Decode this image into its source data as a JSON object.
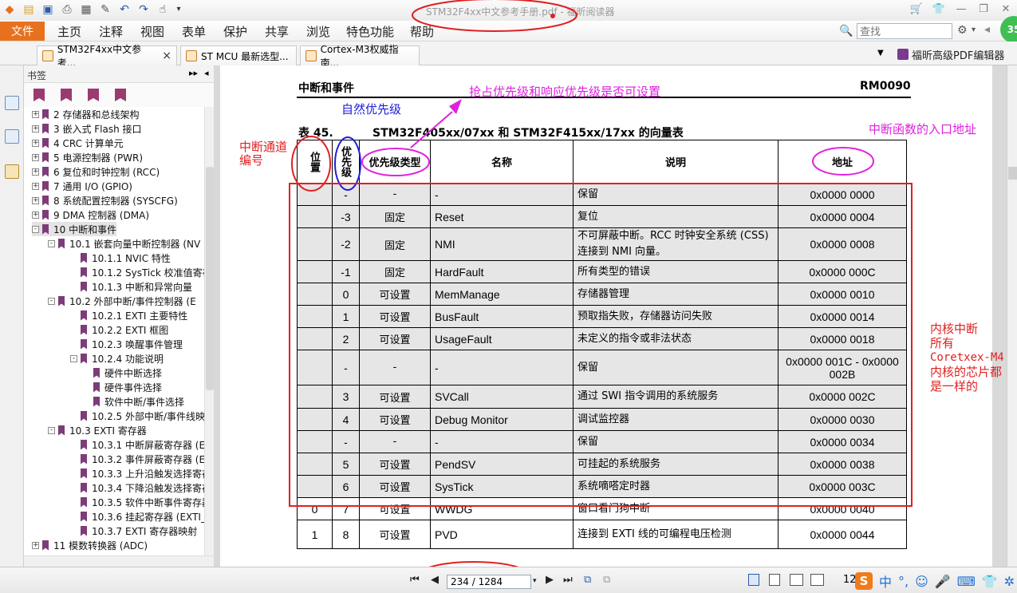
{
  "window": {
    "title": "STM32F4xx中文参考手册.pdf - 福昕阅读器",
    "min_icon": "minimize-icon",
    "max_icon": "restore-icon",
    "close_label": "✕"
  },
  "menu": {
    "file": "文件",
    "items": [
      "主页",
      "注释",
      "视图",
      "表单",
      "保护",
      "共享",
      "浏览",
      "特色功能",
      "帮助"
    ],
    "search_placeholder": "查找"
  },
  "tabs": [
    {
      "label": "STM32F4xx中文参考..."
    },
    {
      "label": "ST MCU 最新选型..."
    },
    {
      "label": "Cortex-M3权威指南..."
    }
  ],
  "editor_button": "福昕高级PDF编辑器",
  "green_badge": "35",
  "bookmarks": {
    "title": "书签",
    "items": [
      {
        "label": "2 存储器和总线架构",
        "level": 0,
        "toggle": "+"
      },
      {
        "label": "3 嵌入式 Flash 接口",
        "level": 0,
        "toggle": "+"
      },
      {
        "label": "4 CRC 计算单元",
        "level": 0,
        "toggle": "+"
      },
      {
        "label": "5 电源控制器 (PWR)",
        "level": 0,
        "toggle": "+"
      },
      {
        "label": "6 复位和时钟控制 (RCC)",
        "level": 0,
        "toggle": "+"
      },
      {
        "label": "7 通用 I/O (GPIO)",
        "level": 0,
        "toggle": "+"
      },
      {
        "label": "8 系统配置控制器 (SYSCFG)",
        "level": 0,
        "toggle": "+"
      },
      {
        "label": "9 DMA 控制器 (DMA)",
        "level": 0,
        "toggle": "+"
      },
      {
        "label": "10 中断和事件",
        "level": 0,
        "toggle": "-",
        "selected": true
      },
      {
        "label": "10.1 嵌套向量中断控制器 (NV",
        "level": 1,
        "toggle": "-"
      },
      {
        "label": "10.1.1 NVIC 特性",
        "level": 2,
        "toggle": ""
      },
      {
        "label": "10.1.2 SysTick 校准值寄存",
        "level": 2,
        "toggle": ""
      },
      {
        "label": "10.1.3 中断和异常向量",
        "level": 2,
        "toggle": ""
      },
      {
        "label": "10.2 外部中断/事件控制器 (E",
        "level": 1,
        "toggle": "-"
      },
      {
        "label": "10.2.1 EXTI 主要特性",
        "level": 2,
        "toggle": ""
      },
      {
        "label": "10.2.2 EXTI 框图",
        "level": 2,
        "toggle": ""
      },
      {
        "label": "10.2.3 唤醒事件管理",
        "level": 2,
        "toggle": ""
      },
      {
        "label": "10.2.4 功能说明",
        "level": 2,
        "toggle": "-"
      },
      {
        "label": "硬件中断选择",
        "level": 3,
        "toggle": ""
      },
      {
        "label": "硬件事件选择",
        "level": 3,
        "toggle": ""
      },
      {
        "label": "软件中断/事件选择",
        "level": 3,
        "toggle": ""
      },
      {
        "label": "10.2.5 外部中断/事件线映",
        "level": 2,
        "toggle": ""
      },
      {
        "label": "10.3 EXTI 寄存器",
        "level": 1,
        "toggle": "-"
      },
      {
        "label": "10.3.1 中断屏蔽寄存器 (E",
        "level": 2,
        "toggle": ""
      },
      {
        "label": "10.3.2 事件屏蔽寄存器 (E",
        "level": 2,
        "toggle": ""
      },
      {
        "label": "10.3.3 上升沿触发选择寄存",
        "level": 2,
        "toggle": ""
      },
      {
        "label": "10.3.4 下降沿触发选择寄存",
        "level": 2,
        "toggle": ""
      },
      {
        "label": "10.3.5 软件中断事件寄存器",
        "level": 2,
        "toggle": ""
      },
      {
        "label": "10.3.6 挂起寄存器 (EXTI_",
        "level": 2,
        "toggle": ""
      },
      {
        "label": "10.3.7 EXTI 寄存器映射",
        "level": 2,
        "toggle": ""
      },
      {
        "label": "11 模数转换器 (ADC)",
        "level": 0,
        "toggle": "+"
      }
    ]
  },
  "document": {
    "section": "中断和事件",
    "doc_id": "RM0090",
    "table_label": "表 45.",
    "table_title": "STM32F405xx/07xx 和 STM32F415xx/17xx 的向量表",
    "columns": {
      "position": "位置",
      "priority": "优先级",
      "priority_type": "优先级类型",
      "name": "名称",
      "description": "说明",
      "address": "地址"
    },
    "rows": [
      {
        "pos": "",
        "pri": "-",
        "type": "-",
        "name": "-",
        "desc": "保留",
        "addr": "0x0000 0000",
        "gray": true
      },
      {
        "pos": "",
        "pri": "-3",
        "type": "固定",
        "name": "Reset",
        "desc": "复位",
        "addr": "0x0000 0004",
        "gray": true
      },
      {
        "pos": "",
        "pri": "-2",
        "type": "固定",
        "name": "NMI",
        "desc": "不可屏蔽中断。RCC 时钟安全系统 (CSS) 连接到 NMI 向量。",
        "addr": "0x0000 0008",
        "gray": true
      },
      {
        "pos": "",
        "pri": "-1",
        "type": "固定",
        "name": "HardFault",
        "desc": "所有类型的错误",
        "addr": "0x0000 000C",
        "gray": true
      },
      {
        "pos": "",
        "pri": "0",
        "type": "可设置",
        "name": "MemManage",
        "desc": "存储器管理",
        "addr": "0x0000 0010",
        "gray": true
      },
      {
        "pos": "",
        "pri": "1",
        "type": "可设置",
        "name": "BusFault",
        "desc": "预取指失败，存储器访问失败",
        "addr": "0x0000 0014",
        "gray": true
      },
      {
        "pos": "",
        "pri": "2",
        "type": "可设置",
        "name": "UsageFault",
        "desc": "未定义的指令或非法状态",
        "addr": "0x0000 0018",
        "gray": true
      },
      {
        "pos": "",
        "pri": "-",
        "type": "-",
        "name": "-",
        "desc": "保留",
        "addr": "0x0000 001C - 0x0000 002B",
        "gray": true
      },
      {
        "pos": "",
        "pri": "3",
        "type": "可设置",
        "name": "SVCall",
        "desc": "通过 SWI 指令调用的系统服务",
        "addr": "0x0000 002C",
        "gray": true
      },
      {
        "pos": "",
        "pri": "4",
        "type": "可设置",
        "name": "Debug Monitor",
        "desc": "调试监控器",
        "addr": "0x0000 0030",
        "gray": true
      },
      {
        "pos": "",
        "pri": "-",
        "type": "-",
        "name": "-",
        "desc": "保留",
        "addr": "0x0000 0034",
        "gray": true
      },
      {
        "pos": "",
        "pri": "5",
        "type": "可设置",
        "name": "PendSV",
        "desc": "可挂起的系统服务",
        "addr": "0x0000 0038",
        "gray": true
      },
      {
        "pos": "",
        "pri": "6",
        "type": "可设置",
        "name": "SysTick",
        "desc": "系统嘀嗒定时器",
        "addr": "0x0000 003C",
        "gray": true
      },
      {
        "pos": "0",
        "pri": "7",
        "type": "可设置",
        "name": "WWDG",
        "desc": "窗口看门狗中断",
        "addr": "0x0000 0040",
        "gray": false
      },
      {
        "pos": "1",
        "pri": "8",
        "type": "可设置",
        "name": "PVD",
        "desc": "连接到 EXTI 线的可编程电压检测",
        "addr": "0x0000 0044",
        "gray": false
      }
    ]
  },
  "annotations": {
    "preempt": "抢占优先级和响应优先级是否可设置",
    "natural": "自然优先级",
    "channel_line1": "中断通道",
    "channel_line2": "编号",
    "entry": "中断函数的入口地址",
    "core_lines": [
      "内核中断",
      "所有",
      "Coretxex-M4",
      "内核的芯片都",
      "是一样的"
    ]
  },
  "status": {
    "page_display": "234 / 1284",
    "zoom": "12"
  },
  "colors": {
    "file_button": "#e8711e",
    "annotation_pink": "#e020e0",
    "annotation_red": "#e02020",
    "annotation_blue": "#2020d8",
    "bookmark_flag": "#7d3c79"
  }
}
